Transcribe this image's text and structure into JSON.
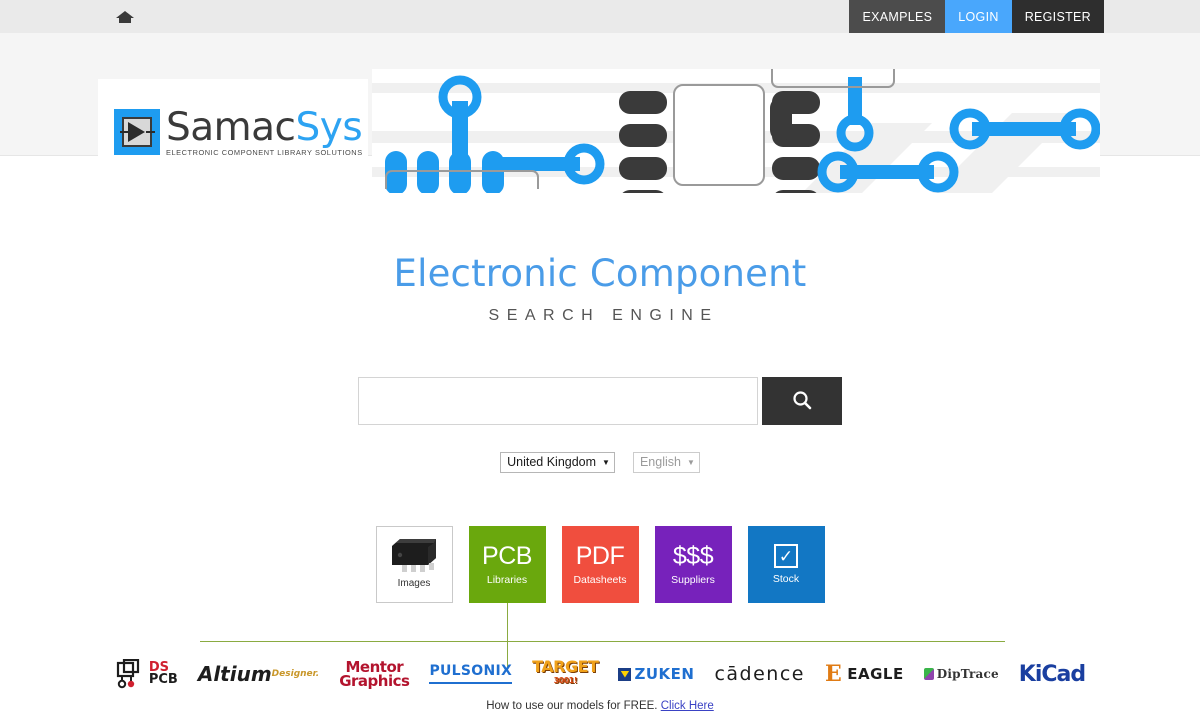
{
  "nav": {
    "home_icon": "home-icon",
    "items": [
      {
        "label": "EXAMPLES",
        "style": "examples"
      },
      {
        "label": "LOGIN",
        "style": "login"
      },
      {
        "label": "REGISTER",
        "style": "register"
      }
    ]
  },
  "header": {
    "logo": {
      "name_part1": "Samac",
      "name_part2": "Sys",
      "tagline": "ELECTRONIC COMPONENT LIBRARY SOLUTIONS",
      "icon": "chip-logo-icon"
    },
    "banner_art": "pcb-trace-banner"
  },
  "hero": {
    "title": "Electronic Component",
    "subtitle": "SEARCH ENGINE"
  },
  "search": {
    "value": "",
    "placeholder": "",
    "button_icon": "search-icon",
    "country": {
      "label": "United Kingdom",
      "caret": "▼"
    },
    "language": {
      "label": "English",
      "caret": "▼"
    }
  },
  "tiles": [
    {
      "name": "images",
      "big": "",
      "caption": "Images",
      "color": "#ffffff",
      "icon": "chip-photo-icon"
    },
    {
      "name": "pcb-libraries",
      "big": "PCB",
      "caption": "Libraries",
      "color": "#6aa80d"
    },
    {
      "name": "pdf-datasheets",
      "big": "PDF",
      "caption": "Datasheets",
      "color": "#f04e3e"
    },
    {
      "name": "suppliers",
      "big": "$$$",
      "caption": "Suppliers",
      "color": "#7722bb"
    },
    {
      "name": "stock",
      "big": "",
      "caption": "Stock",
      "color": "#1277c4",
      "icon": "checkbox-checked-icon"
    }
  ],
  "connector_color": "#8aab41",
  "cad_logos": [
    {
      "name": "dspcb",
      "label": "DS PCB"
    },
    {
      "name": "altium",
      "label": "Altium",
      "sub": "Designer."
    },
    {
      "name": "mentor-graphics",
      "label": "Mentor",
      "sub": "Graphics"
    },
    {
      "name": "pulsonix",
      "label": "PULSONIX"
    },
    {
      "name": "target-3001",
      "label": "TARGET",
      "sub": "3001!"
    },
    {
      "name": "zuken",
      "label": "ZUKEN"
    },
    {
      "name": "cadence",
      "label": "cādence"
    },
    {
      "name": "eagle",
      "label": "EAGLE"
    },
    {
      "name": "diptrace",
      "label": "DipTrace"
    },
    {
      "name": "kicad",
      "label": "KiCad"
    }
  ],
  "footer": {
    "text": "How to use our models for FREE.",
    "link": "Click Here"
  }
}
